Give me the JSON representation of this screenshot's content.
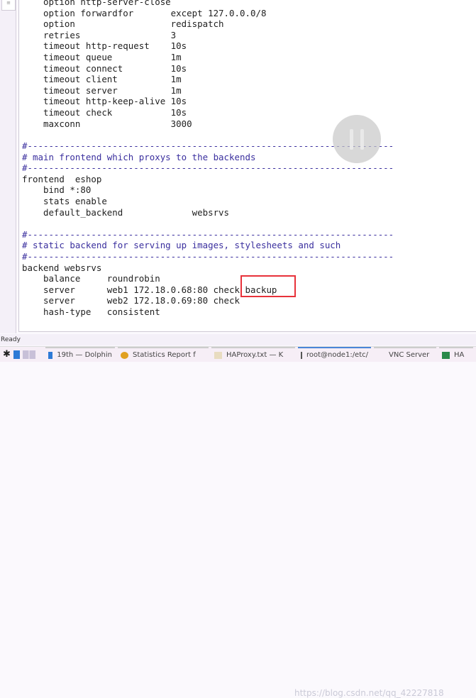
{
  "editor": {
    "lines": [
      {
        "text": "    option http-server-close",
        "comment": false
      },
      {
        "text": "    option forwardfor       except 127.0.0.0/8",
        "comment": false
      },
      {
        "text": "    option                  redispatch",
        "comment": false
      },
      {
        "text": "    retries                 3",
        "comment": false
      },
      {
        "text": "    timeout http-request    10s",
        "comment": false
      },
      {
        "text": "    timeout queue           1m",
        "comment": false
      },
      {
        "text": "    timeout connect         10s",
        "comment": false
      },
      {
        "text": "    timeout client          1m",
        "comment": false
      },
      {
        "text": "    timeout server          1m",
        "comment": false
      },
      {
        "text": "    timeout http-keep-alive 10s",
        "comment": false
      },
      {
        "text": "    timeout check           10s",
        "comment": false
      },
      {
        "text": "    maxconn                 3000",
        "comment": false
      },
      {
        "text": "",
        "comment": false
      },
      {
        "text": "#---------------------------------------------------------------------",
        "comment": true
      },
      {
        "text": "# main frontend which proxys to the backends",
        "comment": true
      },
      {
        "text": "#---------------------------------------------------------------------",
        "comment": true
      },
      {
        "text": "frontend  eshop",
        "comment": false
      },
      {
        "text": "    bind *:80",
        "comment": false
      },
      {
        "text": "    stats enable",
        "comment": false
      },
      {
        "text": "    default_backend             websrvs",
        "comment": false
      },
      {
        "text": "",
        "comment": false
      },
      {
        "text": "#---------------------------------------------------------------------",
        "comment": true
      },
      {
        "text": "# static backend for serving up images, stylesheets and such",
        "comment": true
      },
      {
        "text": "#---------------------------------------------------------------------",
        "comment": true
      },
      {
        "text": "backend websrvs",
        "comment": false
      },
      {
        "text": "    balance     roundrobin",
        "comment": false
      },
      {
        "text": "    server      web1 172.18.0.68:80 check backup",
        "comment": false
      },
      {
        "text": "    server      web2 172.18.0.69:80 check",
        "comment": false
      },
      {
        "text": "    hash-type   consistent",
        "comment": false
      }
    ],
    "highlight_color": "#e8323a"
  },
  "status": {
    "text": "Ready"
  },
  "taskbar": {
    "tasks": [
      {
        "label": "19th — Dolphin",
        "icon": "folder-icon"
      },
      {
        "label": "Statistics Report f",
        "icon": "chrome-icon"
      },
      {
        "label": "HAProxy.txt — K",
        "icon": "text-file-icon"
      },
      {
        "label": "root@node1:/etc/",
        "icon": "terminal-icon"
      },
      {
        "label": "VNC Server",
        "icon": "vnc-icon"
      },
      {
        "label": "HA",
        "icon": "window-icon"
      }
    ]
  },
  "watermark": "https://blog.csdn.net/qq_42227818"
}
